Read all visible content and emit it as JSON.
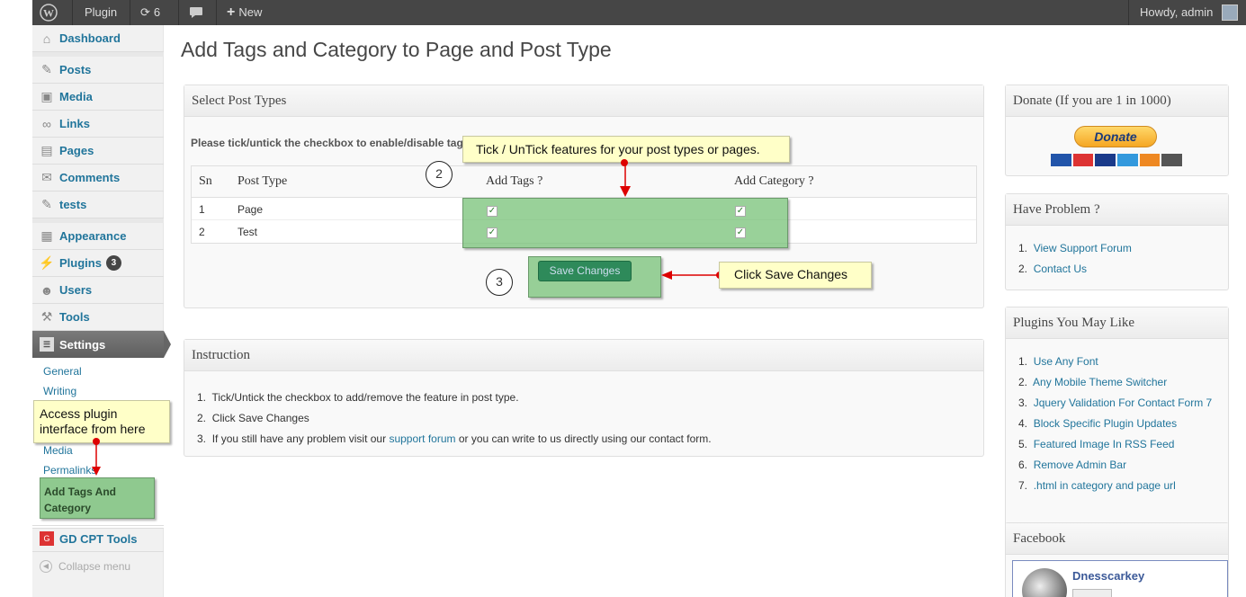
{
  "adminbar": {
    "plugin": "Plugin",
    "updates": "6",
    "new": "New",
    "howdy": "Howdy, admin"
  },
  "menu": {
    "dashboard": "Dashboard",
    "posts": "Posts",
    "media": "Media",
    "links": "Links",
    "pages": "Pages",
    "comments": "Comments",
    "tests": "tests",
    "appearance": "Appearance",
    "plugins": "Plugins",
    "plugins_badge": "3",
    "users": "Users",
    "tools": "Tools",
    "settings": "Settings",
    "gdcpt": "GD CPT Tools",
    "collapse": "Collapse menu",
    "sub": {
      "general": "General",
      "writing": "Writing",
      "media": "Media",
      "permalinks": "Permalinks",
      "addtags_line1": "Add Tags And",
      "addtags_line2": "Category"
    }
  },
  "page": {
    "title": "Add Tags and Category to Page and Post Type",
    "select_box": {
      "title": "Select Post Types",
      "note": "Please tick/untick the checkbox to enable/disable tag",
      "cols": [
        "Sn",
        "Post Type",
        "Add Tags ?",
        "Add Category ?"
      ],
      "rows": [
        {
          "sn": "1",
          "type": "Page"
        },
        {
          "sn": "2",
          "type": "Test"
        }
      ],
      "save": "Save Changes"
    },
    "instruction": {
      "title": "Instruction",
      "item1": "Tick/Untick the checkbox to add/remove the feature in post type.",
      "item2": "Click Save Changes",
      "item3_pre": "If you still have any problem visit our ",
      "item3_link": "support forum",
      "item3_post": " or you can write to us directly using our contact form."
    }
  },
  "sidebar_right": {
    "donate_title": "Donate (If you are 1 in 1000)",
    "donate_btn": "Donate",
    "problem_title": "Have Problem ?",
    "problem_links": [
      "View Support Forum",
      "Contact Us"
    ],
    "plugins_title": "Plugins You May Like",
    "plugins_links": [
      "Use Any Font",
      "Any Mobile Theme Switcher",
      "Jquery Validation For Contact Form 7",
      "Block Specific Plugin Updates",
      "Featured Image In RSS Feed",
      "Remove Admin Bar",
      ".html in category and page url"
    ],
    "facebook_title": "Facebook",
    "facebook_name": "Dnesscarkey"
  },
  "annotations": {
    "tick": "Tick / UnTick features for your post types or pages.",
    "save": "Click Save Changes",
    "access_line1": "Access plugin",
    "access_line2": "interface from here",
    "num2": "2",
    "num3": "3"
  }
}
